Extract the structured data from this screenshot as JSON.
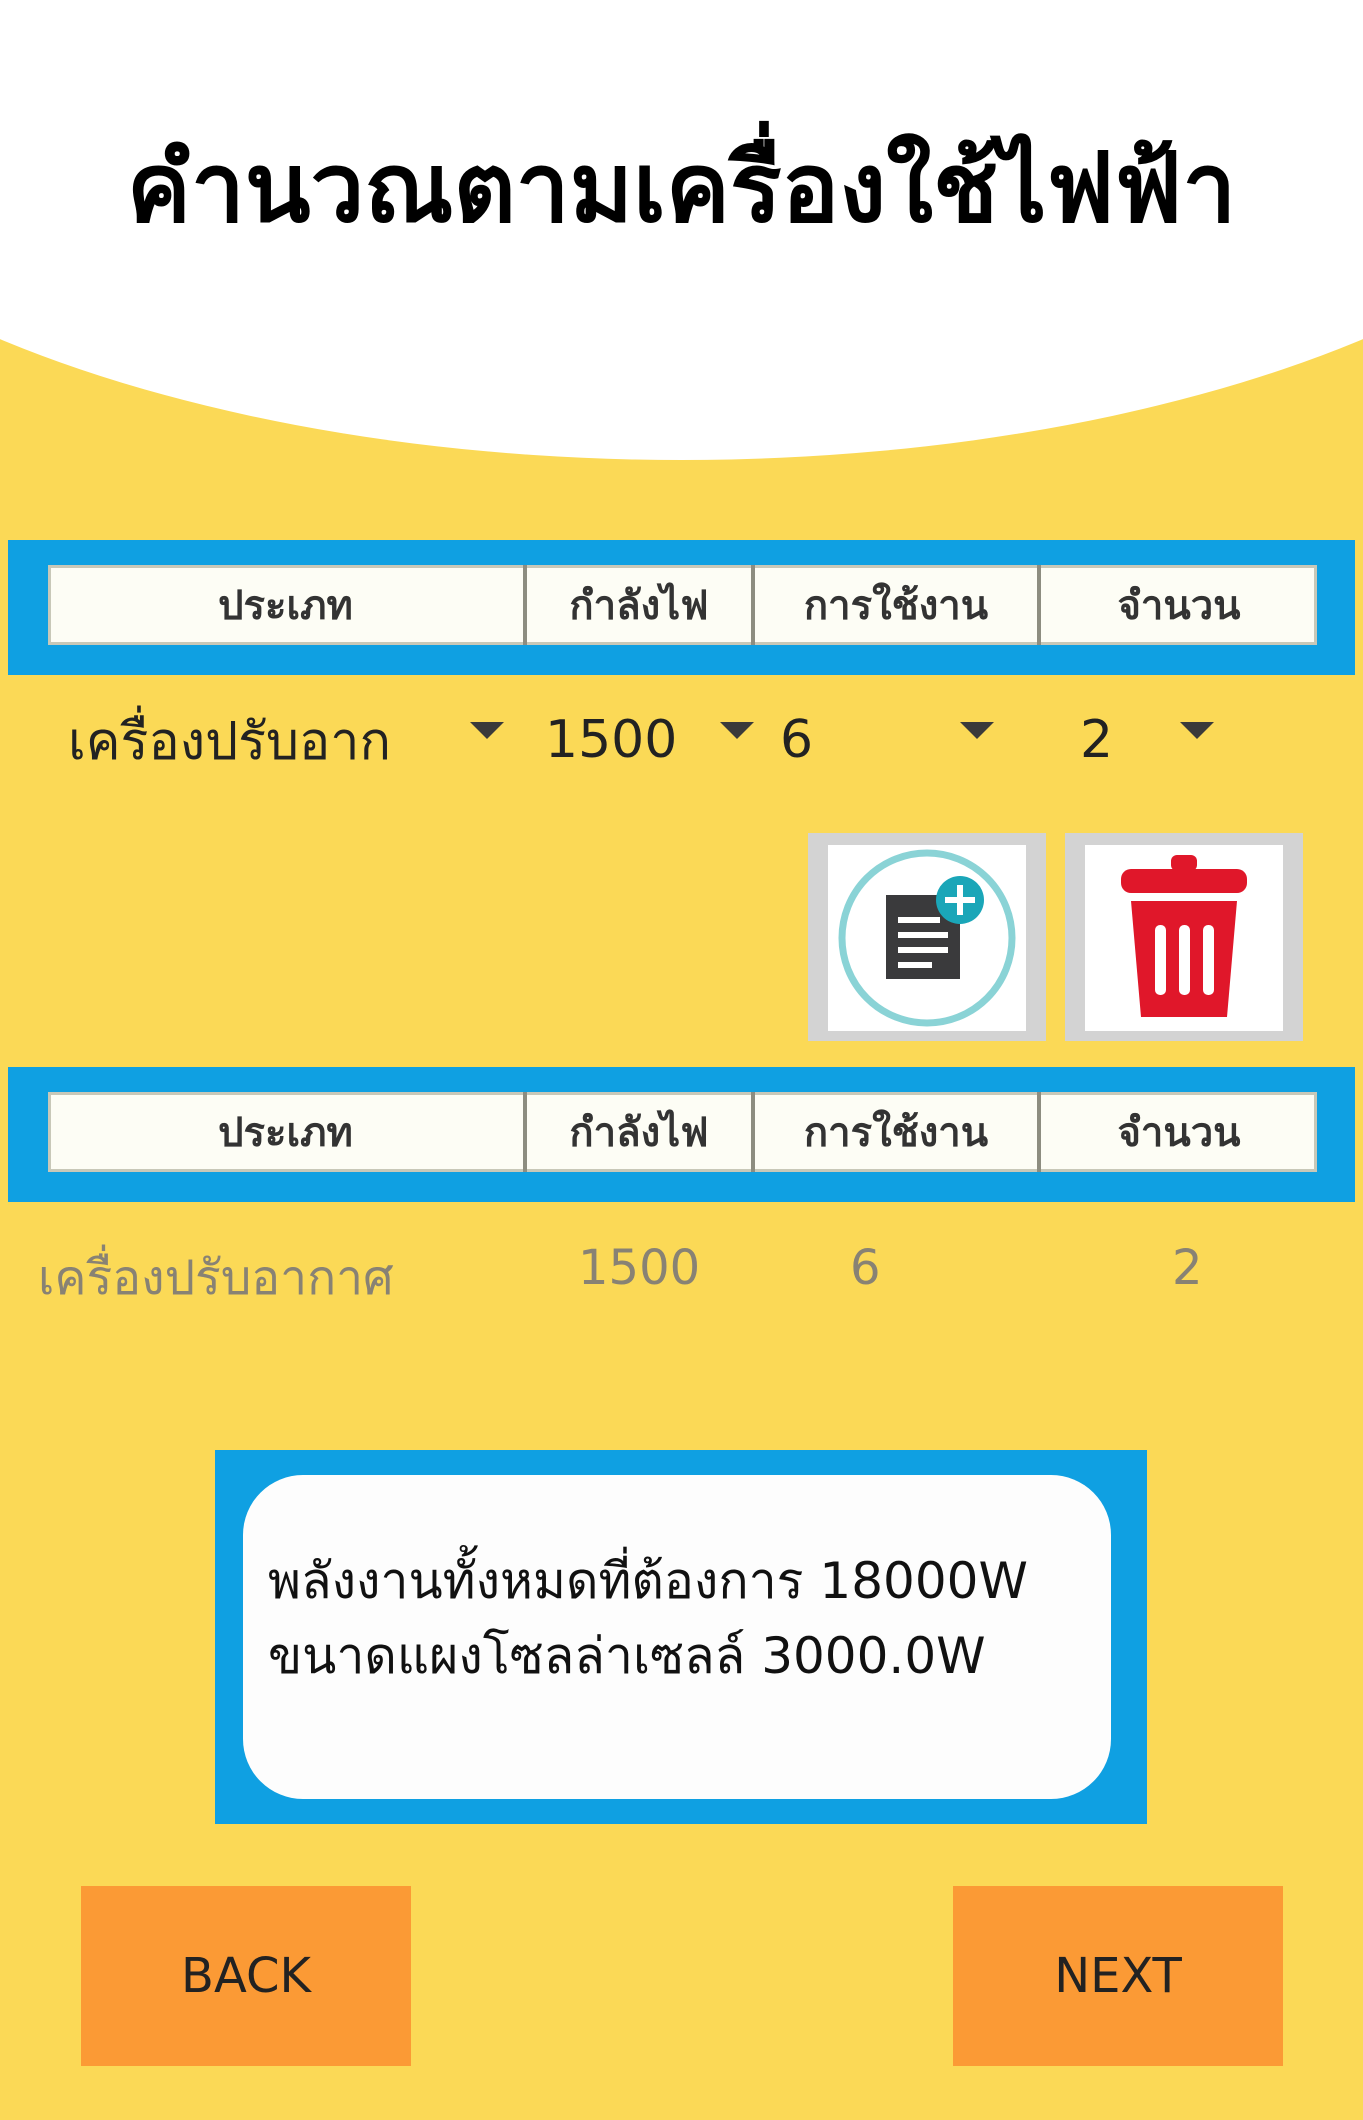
{
  "title": "คำนวณตามเครื่องใช้ไฟฟ้า",
  "table_headers": [
    "ประเภท",
    "กำลังไฟ",
    "การใช้งาน",
    "จำนวน"
  ],
  "inputs": {
    "type": "เครื่องปรับอาก",
    "power": "1500",
    "usage": "6",
    "quantity": "2"
  },
  "actions": {
    "add_icon": "add-note-icon",
    "delete_icon": "trash-icon"
  },
  "rows": [
    {
      "type": "เครื่องปรับอากาศ",
      "power": "1500",
      "usage": "6",
      "quantity": "2"
    }
  ],
  "result": {
    "line1": "พลังงานทั้งหมดที่ต้องการ 18000W",
    "line2": "ขนาดแผงโซลล่าเซลล์ 3000.0W"
  },
  "nav": {
    "back_label": "BACK",
    "next_label": "NEXT"
  },
  "colors": {
    "background": "#fbd956",
    "frame": "#0fa0e2",
    "button": "#fb9a35",
    "delete": "#e0172a"
  }
}
